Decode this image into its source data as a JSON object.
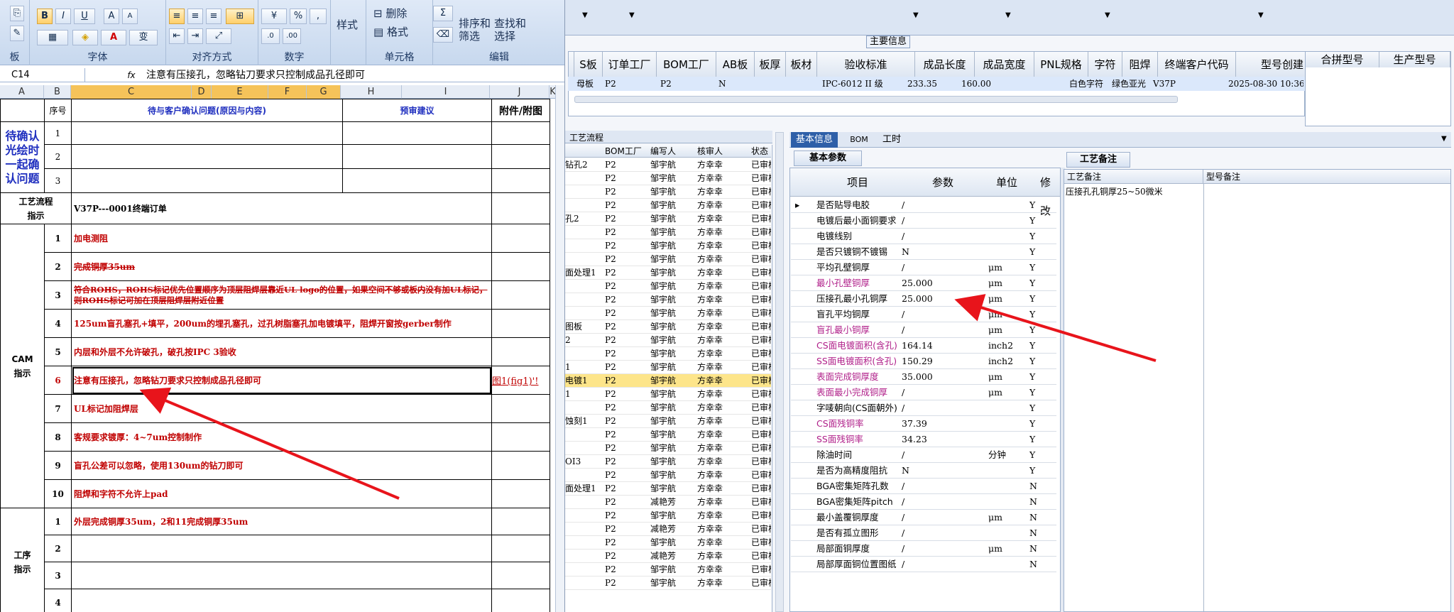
{
  "excel": {
    "ribbon": {
      "groups": [
        "字体",
        "对齐方式",
        "数字",
        "样式",
        "单元格",
        "编辑"
      ],
      "clip_group": "板",
      "style_label": "样式",
      "delete_label": "删除",
      "format_label": "格式",
      "sort_label": "排序和\n筛选",
      "find_label": "查找和\n选择",
      "font_buttons": [
        "B",
        "I",
        "U",
        "A",
        "A"
      ],
      "number_buttons": [
        "%",
        ","
      ]
    },
    "name_box": "C14",
    "formula_text": "注意有压接孔，忽略钻刀要求只控制成品孔径即可",
    "columns": [
      "A",
      "B",
      "C",
      "D",
      "E",
      "F",
      "G",
      "H",
      "I",
      "J",
      "K"
    ],
    "header_row": {
      "seq": "序号",
      "issue": "待与客户确认问题(原因与内容)",
      "advice": "预审建议",
      "attach": "附件/附图"
    },
    "confirm_label": "待确认\n光绘时\n一起确\n认问题",
    "confirm_rows": [
      "1",
      "2",
      "3"
    ],
    "process_label": "工艺流程\n指示",
    "process_text": "V37P---0001终端订单",
    "cam_label": "CAM\n指示",
    "cam_rows": [
      {
        "n": "1",
        "t": "加电测阻"
      },
      {
        "n": "2",
        "t": "完成铜厚35um"
      },
      {
        "n": "3",
        "t": "符合ROHS，ROHS标记优先位置顺序为顶层阻焊层靠近UL logo的位置，如果空间不够或板内没有加UL标记，则ROHS标记可加在顶层阻焊层附近位置"
      },
      {
        "n": "4",
        "t": "125um盲孔塞孔+填平，200um的埋孔塞孔，过孔树脂塞孔加电镀填平，阻焊开窗按gerber制作"
      },
      {
        "n": "5",
        "t": "内层和外层不允许破孔，破孔按IPC 3验收"
      },
      {
        "n": "6",
        "t": "注意有压接孔，忽略钻刀要求只控制成品孔径即可",
        "a": "图1(fig1)'!"
      },
      {
        "n": "7",
        "t": "UL标记加阻焊层"
      },
      {
        "n": "8",
        "t": "客规要求镀厚：4~7um控制制作"
      },
      {
        "n": "9",
        "t": "盲孔公差可以忽略，使用130um的钻刀即可"
      },
      {
        "n": "10",
        "t": "阻焊和字符不允许上pad"
      }
    ],
    "op_label": "工序\n指示",
    "op_rows": [
      {
        "n": "1",
        "t": "外层完成铜厚35um，2和11完成铜厚35um"
      },
      {
        "n": "2",
        "t": ""
      },
      {
        "n": "3",
        "t": ""
      },
      {
        "n": "4",
        "t": ""
      }
    ]
  },
  "app": {
    "main_info_label": "主要信息",
    "top_headers": [
      "S板",
      "订单工厂",
      "BOM工厂",
      "AB板",
      "板厚",
      "板材",
      "验收标准",
      "成品长度",
      "成品宽度",
      "PNL规格",
      "字符",
      "阻焊",
      "终端客户代码",
      "型号创建"
    ],
    "top_row": [
      "母板",
      "P2",
      "P2",
      "N",
      "IPC-6012 II 级",
      "233.35",
      "160.00",
      "白色字符",
      "绿色亚光",
      "V37P",
      "2025-08-30 10:36:0"
    ],
    "right_headers": [
      "合拼型号",
      "生产型号"
    ],
    "list_tab": "工艺流程",
    "list_headers": [
      "BOM工厂",
      "编写人",
      "核审人",
      "状态"
    ],
    "list_rows": [
      {
        "l": "钻孔2",
        "f": "P2",
        "w": "邹宇航",
        "r": "方幸幸",
        "s": "已审核"
      },
      {
        "l": "",
        "f": "P2",
        "w": "邹宇航",
        "r": "方幸幸",
        "s": "已审核"
      },
      {
        "l": "",
        "f": "P2",
        "w": "邹宇航",
        "r": "方幸幸",
        "s": "已审核"
      },
      {
        "l": "",
        "f": "P2",
        "w": "邹宇航",
        "r": "方幸幸",
        "s": "已审核"
      },
      {
        "l": "孔2",
        "f": "P2",
        "w": "邹宇航",
        "r": "方幸幸",
        "s": "已审核"
      },
      {
        "l": "",
        "f": "P2",
        "w": "邹宇航",
        "r": "方幸幸",
        "s": "已审核"
      },
      {
        "l": "",
        "f": "P2",
        "w": "邹宇航",
        "r": "方幸幸",
        "s": "已审核"
      },
      {
        "l": "",
        "f": "P2",
        "w": "邹宇航",
        "r": "方幸幸",
        "s": "已审核"
      },
      {
        "l": "面处理1",
        "f": "P2",
        "w": "邹宇航",
        "r": "方幸幸",
        "s": "已审核"
      },
      {
        "l": "",
        "f": "P2",
        "w": "邹宇航",
        "r": "方幸幸",
        "s": "已审核"
      },
      {
        "l": "",
        "f": "P2",
        "w": "邹宇航",
        "r": "方幸幸",
        "s": "已审核"
      },
      {
        "l": "",
        "f": "P2",
        "w": "邹宇航",
        "r": "方幸幸",
        "s": "已审核"
      },
      {
        "l": "图板",
        "f": "P2",
        "w": "邹宇航",
        "r": "方幸幸",
        "s": "已审核"
      },
      {
        "l": "2",
        "f": "P2",
        "w": "邹宇航",
        "r": "方幸幸",
        "s": "已审核"
      },
      {
        "l": "",
        "f": "P2",
        "w": "邹宇航",
        "r": "方幸幸",
        "s": "已审核"
      },
      {
        "l": "1",
        "f": "P2",
        "w": "邹宇航",
        "r": "方幸幸",
        "s": "已审核"
      },
      {
        "l": "电镀1",
        "f": "P2",
        "w": "邹宇航",
        "r": "方幸幸",
        "s": "已审核",
        "hl": true
      },
      {
        "l": "1",
        "f": "P2",
        "w": "邹宇航",
        "r": "方幸幸",
        "s": "已审核"
      },
      {
        "l": "",
        "f": "P2",
        "w": "邹宇航",
        "r": "方幸幸",
        "s": "已审核"
      },
      {
        "l": "蚀刻1",
        "f": "P2",
        "w": "邹宇航",
        "r": "方幸幸",
        "s": "已审核"
      },
      {
        "l": "",
        "f": "P2",
        "w": "邹宇航",
        "r": "方幸幸",
        "s": "已审核"
      },
      {
        "l": "",
        "f": "P2",
        "w": "邹宇航",
        "r": "方幸幸",
        "s": "已审核"
      },
      {
        "l": "OI3",
        "f": "P2",
        "w": "邹宇航",
        "r": "方幸幸",
        "s": "已审核"
      },
      {
        "l": "",
        "f": "P2",
        "w": "邹宇航",
        "r": "方幸幸",
        "s": "已审核"
      },
      {
        "l": "面处理1",
        "f": "P2",
        "w": "邹宇航",
        "r": "方幸幸",
        "s": "已审核"
      },
      {
        "l": "",
        "f": "P2",
        "w": "减艳芳",
        "r": "方幸幸",
        "s": "已审核"
      },
      {
        "l": "",
        "f": "P2",
        "w": "邹宇航",
        "r": "方幸幸",
        "s": "已审核"
      },
      {
        "l": "",
        "f": "P2",
        "w": "减艳芳",
        "r": "方幸幸",
        "s": "已审核"
      },
      {
        "l": "",
        "f": "P2",
        "w": "邹宇航",
        "r": "方幸幸",
        "s": "已审核"
      },
      {
        "l": "",
        "f": "P2",
        "w": "减艳芳",
        "r": "方幸幸",
        "s": "已审核"
      },
      {
        "l": "",
        "f": "P2",
        "w": "邹宇航",
        "r": "方幸幸",
        "s": "已审核"
      },
      {
        "l": "",
        "f": "P2",
        "w": "邹宇航",
        "r": "方幸幸",
        "s": "已审核"
      }
    ],
    "tabs": [
      "基本信息",
      "BOM",
      "工时"
    ],
    "basic_sub_tab": "基本参数",
    "basic_headers": [
      "项目",
      "参数",
      "单位",
      "修改"
    ],
    "params": [
      {
        "i": "是否贴导电胶",
        "p": "/",
        "u": "",
        "m": "Y"
      },
      {
        "i": "电镀后最小面铜要求",
        "p": "/",
        "u": "",
        "m": "Y"
      },
      {
        "i": "电镀线别",
        "p": "/",
        "u": "",
        "m": "Y"
      },
      {
        "i": "是否只镀铜不镀锡",
        "p": "N",
        "u": "",
        "m": "Y"
      },
      {
        "i": "平均孔壁铜厚",
        "p": "/",
        "u": "μm",
        "m": "Y"
      },
      {
        "i": "最小孔壁铜厚",
        "p": "25.000",
        "u": "μm",
        "m": "Y",
        "c": "pur"
      },
      {
        "i": "压接孔最小孔铜厚",
        "p": "25.000",
        "u": "μm",
        "m": "Y"
      },
      {
        "i": "盲孔平均铜厚",
        "p": "/",
        "u": "μm",
        "m": "Y"
      },
      {
        "i": "盲孔最小铜厚",
        "p": "/",
        "u": "μm",
        "m": "Y",
        "c": "pur"
      },
      {
        "i": "CS面电镀面积(含孔)",
        "p": "164.14",
        "u": "inch2",
        "m": "Y",
        "c": "pur"
      },
      {
        "i": "SS面电镀面积(含孔)",
        "p": "150.29",
        "u": "inch2",
        "m": "Y",
        "c": "pur"
      },
      {
        "i": "表面完成铜厚度",
        "p": "35.000",
        "u": "μm",
        "m": "Y",
        "c": "pur"
      },
      {
        "i": "表面最小完成铜厚",
        "p": "/",
        "u": "μm",
        "m": "Y",
        "c": "pur"
      },
      {
        "i": "字唛朝向(CS面朝外)",
        "p": "/",
        "u": "",
        "m": "Y"
      },
      {
        "i": "CS面残铜率",
        "p": "37.39",
        "u": "",
        "m": "Y",
        "c": "pur"
      },
      {
        "i": "SS面残铜率",
        "p": "34.23",
        "u": "",
        "m": "Y",
        "c": "pur"
      },
      {
        "i": "除油时间",
        "p": "/",
        "u": "分钟",
        "m": "Y"
      },
      {
        "i": "是否为高精度阻抗",
        "p": "N",
        "u": "",
        "m": "Y"
      },
      {
        "i": "BGA密集矩阵孔数",
        "p": "/",
        "u": "",
        "m": "N"
      },
      {
        "i": "BGA密集矩阵pitch",
        "p": "/",
        "u": "",
        "m": "N"
      },
      {
        "i": "最小盖覆铜厚度",
        "p": "/",
        "u": "μm",
        "m": "N"
      },
      {
        "i": "是否有孤立图形",
        "p": "/",
        "u": "",
        "m": "N"
      },
      {
        "i": "局部面铜厚度",
        "p": "/",
        "u": "μm",
        "m": "N"
      },
      {
        "i": "局部厚面铜位置图纸",
        "p": "/",
        "u": "",
        "m": "N"
      }
    ],
    "notes_tab": "工艺备注",
    "notes_headers": [
      "工艺备注",
      "型号备注"
    ],
    "notes_text": "压接孔孔铜厚25~50微米"
  }
}
